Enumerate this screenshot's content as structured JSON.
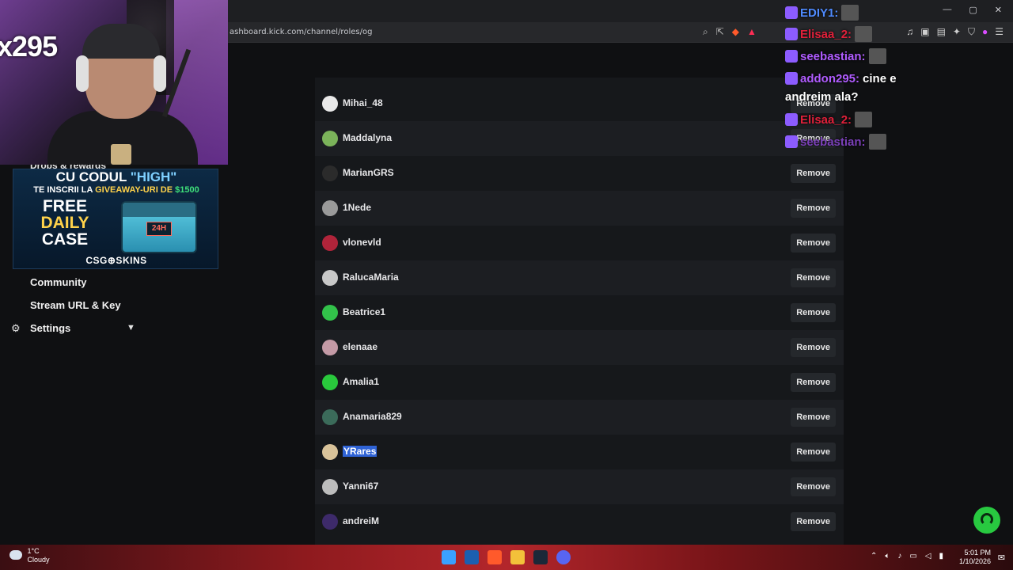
{
  "browser": {
    "url": "ashboard.kick.com/channel/roles/og",
    "window_controls": [
      "—",
      "▢",
      "✕"
    ]
  },
  "webcam": {
    "overlay_text": "x295"
  },
  "ad": {
    "line1_pre": "CU CODUL ",
    "line1_code": "\"HIGH\"",
    "line2_pre": "TE INSCRII LA ",
    "line2_mid": "GIVEAWAY-URI DE ",
    "line2_amount": "$1500",
    "free": "FREE",
    "daily": "DAILY",
    "case": "CASE",
    "case_label": "24H",
    "brand": "CSG⊕SKINS"
  },
  "sidebar": {
    "partial_item": "Drops & rewards",
    "items": [
      {
        "label": "Community"
      },
      {
        "label": "Stream URL & Key"
      },
      {
        "label": "Settings"
      }
    ]
  },
  "roles": {
    "remove_label": "Remove",
    "users": [
      {
        "name": "Mihai_48",
        "avatar_color": "#e9e9e9"
      },
      {
        "name": "Maddalyna",
        "avatar_color": "#7bb35a"
      },
      {
        "name": "MarianGRS",
        "avatar_color": "#2b2b2b"
      },
      {
        "name": "1Nede",
        "avatar_color": "#9a9a9a"
      },
      {
        "name": "vlonevld",
        "avatar_color": "#b0243a"
      },
      {
        "name": "RalucaMaria",
        "avatar_color": "#c8c8c8"
      },
      {
        "name": "Beatrice1",
        "avatar_color": "#32c24a"
      },
      {
        "name": "elenaae",
        "avatar_color": "#c49aa6"
      },
      {
        "name": "Amalia1",
        "avatar_color": "#29c93c"
      },
      {
        "name": "Anamaria829",
        "avatar_color": "#3b6b5a"
      },
      {
        "name": "YRares",
        "avatar_color": "#d9c39a",
        "selected": true
      },
      {
        "name": "Yanni67",
        "avatar_color": "#bdbdbd"
      },
      {
        "name": "andreiM",
        "avatar_color": "#3d2a6a"
      }
    ]
  },
  "chat": [
    {
      "user": "EDIY1:",
      "color": "#4f8bff",
      "text": ""
    },
    {
      "user": "Elisaa_2:",
      "color": "#e0203a",
      "text": ""
    },
    {
      "user": "seebastian:",
      "color": "#b05cff",
      "text": ""
    },
    {
      "user": "addon295:",
      "color": "#b05cff",
      "text": "cine e"
    },
    {
      "user": "",
      "color": "#ffffff",
      "text": "andreim ala?"
    },
    {
      "user": "Elisaa_2:",
      "color": "#e0203a",
      "text": ""
    },
    {
      "user": "seebastian:",
      "color": "#7a3fb8",
      "text": ""
    }
  ],
  "taskbar": {
    "temp": "1°C",
    "condition": "Cloudy",
    "time": "5:01 PM",
    "date": "1/10/2026"
  }
}
